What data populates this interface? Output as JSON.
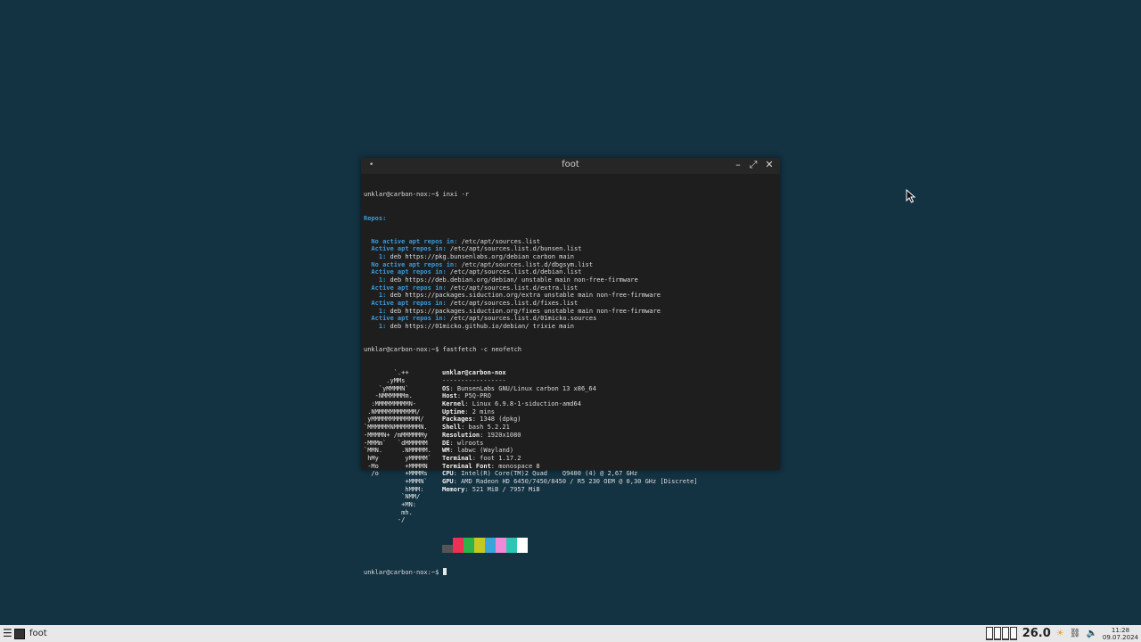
{
  "window": {
    "title": "foot",
    "menu_glyph": "•",
    "minimize_glyph": "–",
    "maximize_glyph": "⤢",
    "close_glyph": "✕"
  },
  "terminal": {
    "inxi_prompt": "unklar@carbon-nox:~$ inxi -r",
    "repos_header": "Repos:",
    "repo_lines": [
      {
        "label": "  No active apt repos in:",
        "value": " /etc/apt/sources.list"
      },
      {
        "label": "  Active apt repos in:",
        "value": " /etc/apt/sources.list.d/bunsen.list"
      },
      {
        "label": "    1:",
        "value": " deb https://pkg.bunsenlabs.org/debian carbon main"
      },
      {
        "label": "  No active apt repos in:",
        "value": " /etc/apt/sources.list.d/dbgsym.list"
      },
      {
        "label": "  Active apt repos in:",
        "value": " /etc/apt/sources.list.d/debian.list"
      },
      {
        "label": "    1:",
        "value": " deb https://deb.debian.org/debian/ unstable main non-free-firmware"
      },
      {
        "label": "  Active apt repos in:",
        "value": " /etc/apt/sources.list.d/extra.list"
      },
      {
        "label": "    1:",
        "value": " deb https://packages.siduction.org/extra unstable main non-free-firmware"
      },
      {
        "label": "  Active apt repos in:",
        "value": " /etc/apt/sources.list.d/fixes.list"
      },
      {
        "label": "    1:",
        "value": " deb https://packages.siduction.org/fixes unstable main non-free-firmware"
      },
      {
        "label": "  Active apt repos in:",
        "value": " /etc/apt/sources.list.d/01micko.sources"
      },
      {
        "label": "    1:",
        "value": " deb https://01micko.github.io/debian/ trixie main"
      }
    ],
    "fastfetch_prompt": "unklar@carbon-nox:~$ fastfetch -c neofetch",
    "fetch_rows": [
      {
        "logo": "        `.++",
        "key": "",
        "value": "unklar@carbon-nox"
      },
      {
        "logo": "      .yMMs",
        "key": "",
        "value": "-----------------"
      },
      {
        "logo": "    `yMMMMN`",
        "key": "OS",
        "value": ": BunsenLabs GNU/Linux carbon 13 x86_64"
      },
      {
        "logo": "   -NMMMMMMm.",
        "key": "Host",
        "value": ": P5Q-PRO"
      },
      {
        "logo": "  :MMMMMMMMMN-",
        "key": "Kernel",
        "value": ": Linux 6.9.8-1-siduction-amd64"
      },
      {
        "logo": " .NMMMMMMMMMMM/",
        "key": "Uptime",
        "value": ": 2 mins"
      },
      {
        "logo": " yMMMMMMMMMMMMM/",
        "key": "Packages",
        "value": ": 1348 (dpkg)"
      },
      {
        "logo": "`MMMMMMNMMMMMMMN.",
        "key": "Shell",
        "value": ": bash 5.2.21"
      },
      {
        "logo": "-MMMMN+ /mMMMMMMy",
        "key": "Resolution",
        "value": ": 1920x1080"
      },
      {
        "logo": "-MMMm`   `dMMMMMM",
        "key": "DE",
        "value": ": wlroots"
      },
      {
        "logo": "`MMN.     .NMMMMM.",
        "key": "WM",
        "value": ": labwc (Wayland)"
      },
      {
        "logo": " hMy       yMMMMM`",
        "key": "Terminal",
        "value": ": foot 1.17.2"
      },
      {
        "logo": " -Mo       +MMMMN",
        "key": "Terminal Font",
        "value": ": monospace 8"
      },
      {
        "logo": "  /o       +MMMMs",
        "key": "CPU",
        "value": ": Intel(R) Core(TM)2 Quad    Q9400 (4) @ 2,67 GHz"
      },
      {
        "logo": "           +MMMN`",
        "key": "GPU",
        "value": ": AMD Radeon HD 6450/7450/8450 / R5 230 OEM @ 0,30 GHz [Discrete]"
      },
      {
        "logo": "           hMMM:",
        "key": "Memory",
        "value": ": 521 MiB / 7957 MiB"
      },
      {
        "logo": "          `NMM/",
        "key": "",
        "value": ""
      },
      {
        "logo": "          +MN:",
        "key": "",
        "value": ""
      },
      {
        "logo": "          mh.",
        "key": "",
        "value": ""
      },
      {
        "logo": "         -/",
        "key": "",
        "value": ""
      }
    ],
    "palette": [
      "#555555",
      "#ef2f55",
      "#2db34a",
      "#c7c724",
      "#38a5dc",
      "#f08ad8",
      "#2cc6b3",
      "#ffffff"
    ],
    "final_prompt": "unklar@carbon-nox:~$ "
  },
  "taskbar": {
    "menu_glyph": "☰",
    "task_label": "foot",
    "cpu_levels": [
      0.05,
      0.05,
      0.05,
      0.05
    ],
    "temperature": "26.0",
    "time": "11:28",
    "date": "09.07.2024"
  },
  "colors": {
    "desktop": "#133242",
    "accent_blue": "#3a9ad9"
  }
}
